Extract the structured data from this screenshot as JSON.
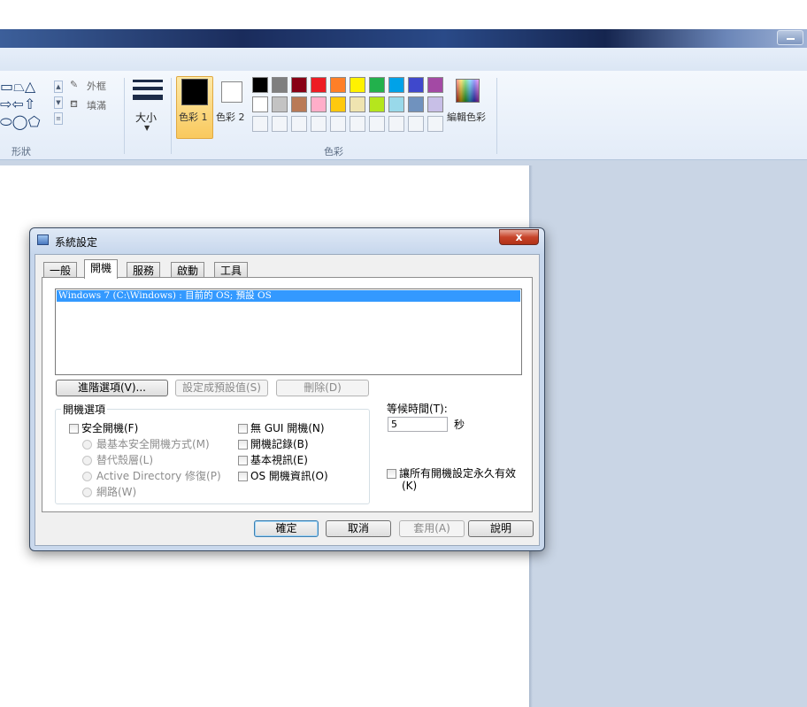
{
  "ribbon": {
    "shapes_group_label": "形狀",
    "outline_label": "外框",
    "fill_label": "填滿",
    "size_label": "大小",
    "color1_label": "色彩 1",
    "color2_label": "色彩 2",
    "colors_group_label": "色彩",
    "edit_colors_label": "編輯色彩",
    "shape_glyphs_row1": "▭⏢△",
    "shape_glyphs_row2": "⇨⇦⇧",
    "shape_glyphs_row3": "⬭◯⬠",
    "palette_row1": [
      "#000000",
      "#7f7f7f",
      "#880015",
      "#ed1c24",
      "#ff7f27",
      "#fff200",
      "#22b14c",
      "#00a2e8",
      "#3f48cc",
      "#a349a4"
    ],
    "palette_row2": [
      "#ffffff",
      "#c3c3c3",
      "#b97a57",
      "#ffaec9",
      "#ffc90e",
      "#efe4b0",
      "#b5e61d",
      "#99d9ea",
      "#7092be",
      "#c8bfe7"
    ],
    "color1_value": "#000000",
    "color2_value": "#ffffff"
  },
  "dialog": {
    "title": "系統設定",
    "close_glyph": "x",
    "tabs": [
      "一般",
      "開機",
      "服務",
      "啟動",
      "工具"
    ],
    "active_tab": "開機",
    "os_entry": "Windows 7 (C:\\Windows) : 目前的 OS; 預設 OS",
    "advanced_button": "進階選項(V)...",
    "set_default_button": "設定成預設值(S)",
    "delete_button": "刪除(D)",
    "boot_options_label": "開機選項",
    "safe_boot": "安全開機(F)",
    "safe_minimal": "最基本安全開機方式(M)",
    "safe_alternate_shell": "替代殼層(L)",
    "safe_ad_repair": "Active Directory 修復(P)",
    "safe_network": "網路(W)",
    "no_gui_boot": "無 GUI 開機(N)",
    "boot_log": "開機記錄(B)",
    "base_video": "基本視訊(E)",
    "os_boot_info": "OS 開機資訊(O)",
    "timeout_label": "等候時間(T):",
    "timeout_value": "5",
    "timeout_unit": "秒",
    "permanent_label_1": "讓所有開機設定永久有效",
    "permanent_label_2": "(K)",
    "ok_button": "確定",
    "cancel_button": "取消",
    "apply_button": "套用(A)",
    "help_button": "說明"
  }
}
